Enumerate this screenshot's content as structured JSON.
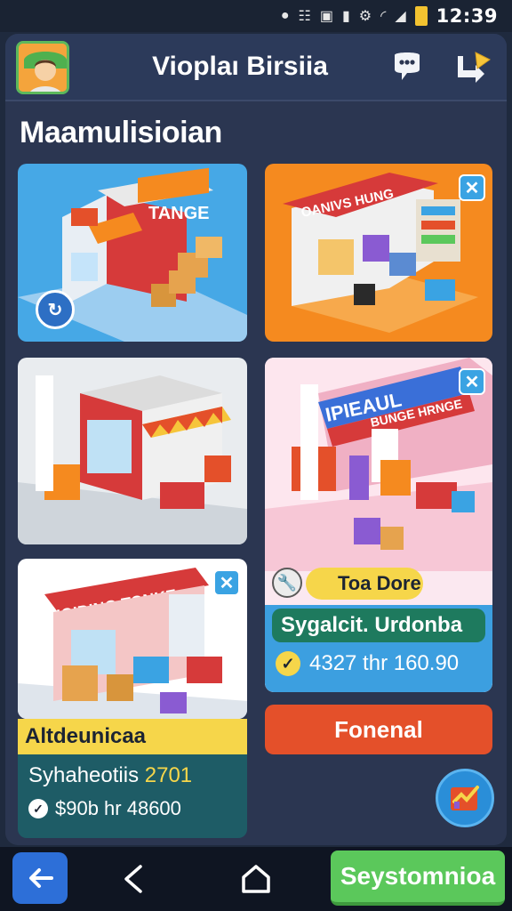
{
  "status_bar": {
    "time": "12:39",
    "icons": [
      "dot",
      "nfc-icon",
      "screenshot-icon",
      "signal-bars-icon",
      "vibrate-icon",
      "wifi-icon",
      "cell-signal-icon",
      "battery-icon"
    ]
  },
  "header": {
    "title": "Vioplaı Birsiia",
    "icons": [
      "avatar-icon",
      "chat-icon",
      "share-icon"
    ]
  },
  "section": {
    "title": "Maamulisioian"
  },
  "cards": [
    {
      "name": "store-card-1",
      "sign": "TANGE",
      "badge": "↻"
    },
    {
      "name": "store-card-2",
      "sign": "OANIVS HUNG",
      "close": "✕"
    },
    {
      "name": "store-card-3"
    },
    {
      "name": "store-card-4",
      "sign": "IPIEAUL BUNGE HRNGE",
      "close": "✕"
    },
    {
      "name": "store-card-5",
      "sign": "IOIDING TONKE",
      "close": "✕"
    }
  ],
  "card4_info": {
    "todo_label": "Toa Dore",
    "line1": "Sygalcit. Urdonba",
    "price": "4327 thr 160.90",
    "check": "✓"
  },
  "card5_info": {
    "banner": "Altdeunicaa",
    "line1_text": "Syhaheotiis",
    "line1_num": "2701",
    "line2": "$90b hr 48600",
    "check": "✓"
  },
  "buttons": {
    "fornal": "Fonenal",
    "green": "Seystomnioa"
  },
  "colors": {
    "background": "#1f2a3e",
    "panel": "#2b3651",
    "accent_blue": "#3aa3e3",
    "accent_orange": "#f58a1f",
    "accent_yellow": "#f6d64a",
    "accent_red": "#e4502a",
    "accent_green": "#5bc85b"
  }
}
